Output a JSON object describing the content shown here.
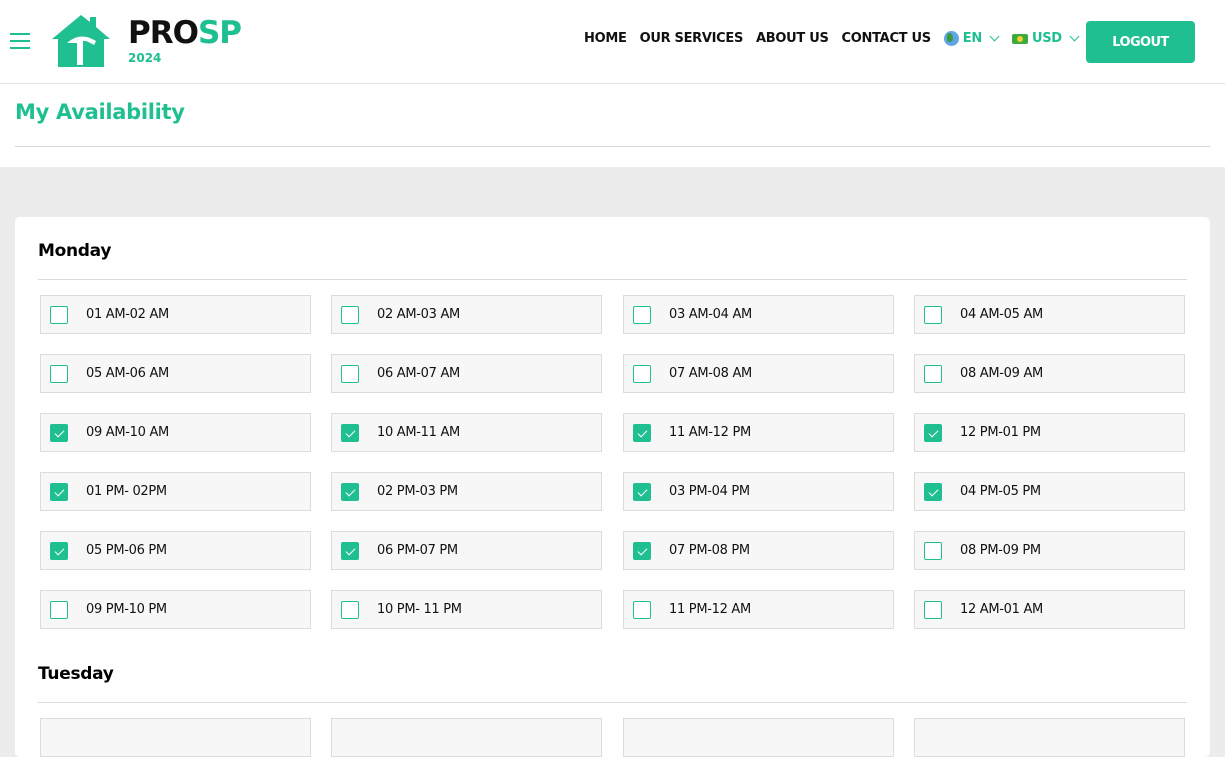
{
  "header": {
    "logo": {
      "brand_dark": "PRO",
      "brand_accent": "SP",
      "year": "2024"
    },
    "nav": {
      "items": [
        "HOME",
        "OUR SERVICES",
        "ABOUT US",
        "CONTACT US"
      ],
      "language": {
        "icon": "globe-icon",
        "value": "EN"
      },
      "currency": {
        "icon": "money-icon",
        "value": "USD"
      },
      "logout_label": "LOGOUT"
    }
  },
  "colors": {
    "accent": "#1fbf92",
    "background": "#ececec"
  },
  "page": {
    "title": "My Availability"
  },
  "days": [
    {
      "name": "Monday",
      "slots": [
        {
          "label": "01 AM-02 AM",
          "checked": false
        },
        {
          "label": "02 AM-03 AM",
          "checked": false
        },
        {
          "label": "03 AM-04 AM",
          "checked": false
        },
        {
          "label": "04 AM-05 AM",
          "checked": false
        },
        {
          "label": "05 AM-06 AM",
          "checked": false
        },
        {
          "label": "06 AM-07 AM",
          "checked": false
        },
        {
          "label": "07 AM-08 AM",
          "checked": false
        },
        {
          "label": "08 AM-09 AM",
          "checked": false
        },
        {
          "label": "09 AM-10 AM",
          "checked": true
        },
        {
          "label": "10 AM-11 AM",
          "checked": true
        },
        {
          "label": "11 AM-12 PM",
          "checked": true
        },
        {
          "label": "12 PM-01 PM",
          "checked": true
        },
        {
          "label": "01 PM- 02PM",
          "checked": true
        },
        {
          "label": "02 PM-03 PM",
          "checked": true
        },
        {
          "label": "03 PM-04 PM",
          "checked": true
        },
        {
          "label": "04 PM-05 PM",
          "checked": true
        },
        {
          "label": "05 PM-06 PM",
          "checked": true
        },
        {
          "label": "06 PM-07 PM",
          "checked": true
        },
        {
          "label": "07 PM-08 PM",
          "checked": true
        },
        {
          "label": "08 PM-09 PM",
          "checked": false
        },
        {
          "label": "09 PM-10 PM",
          "checked": false
        },
        {
          "label": "10 PM- 11 PM",
          "checked": false
        },
        {
          "label": "11 PM-12 AM",
          "checked": false
        },
        {
          "label": "12 AM-01 AM",
          "checked": false
        }
      ]
    },
    {
      "name": "Tuesday",
      "slots": []
    }
  ]
}
